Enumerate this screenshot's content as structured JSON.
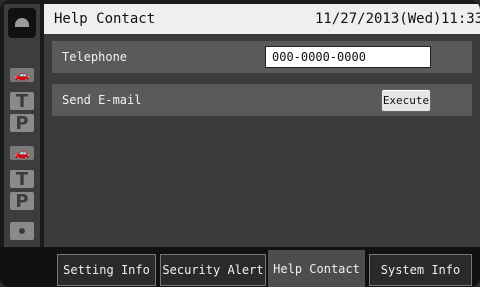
{
  "header": {
    "title": "Help Contact",
    "date": "11/27/2013(Wed)",
    "time": "11:33"
  },
  "rail": {
    "home_icon": "home-icon",
    "items": [
      "car-icon",
      "T",
      "P",
      "car-icon",
      "T",
      "P",
      "dot-icon"
    ]
  },
  "main": {
    "telephone": {
      "label": "Telephone",
      "value": "000-0000-0000"
    },
    "email": {
      "label": "Send E-mail",
      "button_label": "Execute"
    }
  },
  "tabs": [
    {
      "label": "Setting Info",
      "active": false
    },
    {
      "label": "Security Alert",
      "active": false
    },
    {
      "label": "Help Contact",
      "active": true
    },
    {
      "label": "System Info",
      "active": false
    }
  ],
  "colors": {
    "header_bg": "#efefef",
    "panel_bg": "#3b3b3b",
    "row_bg": "#5a5a5a",
    "rail_bg": "#3d3d3d"
  }
}
